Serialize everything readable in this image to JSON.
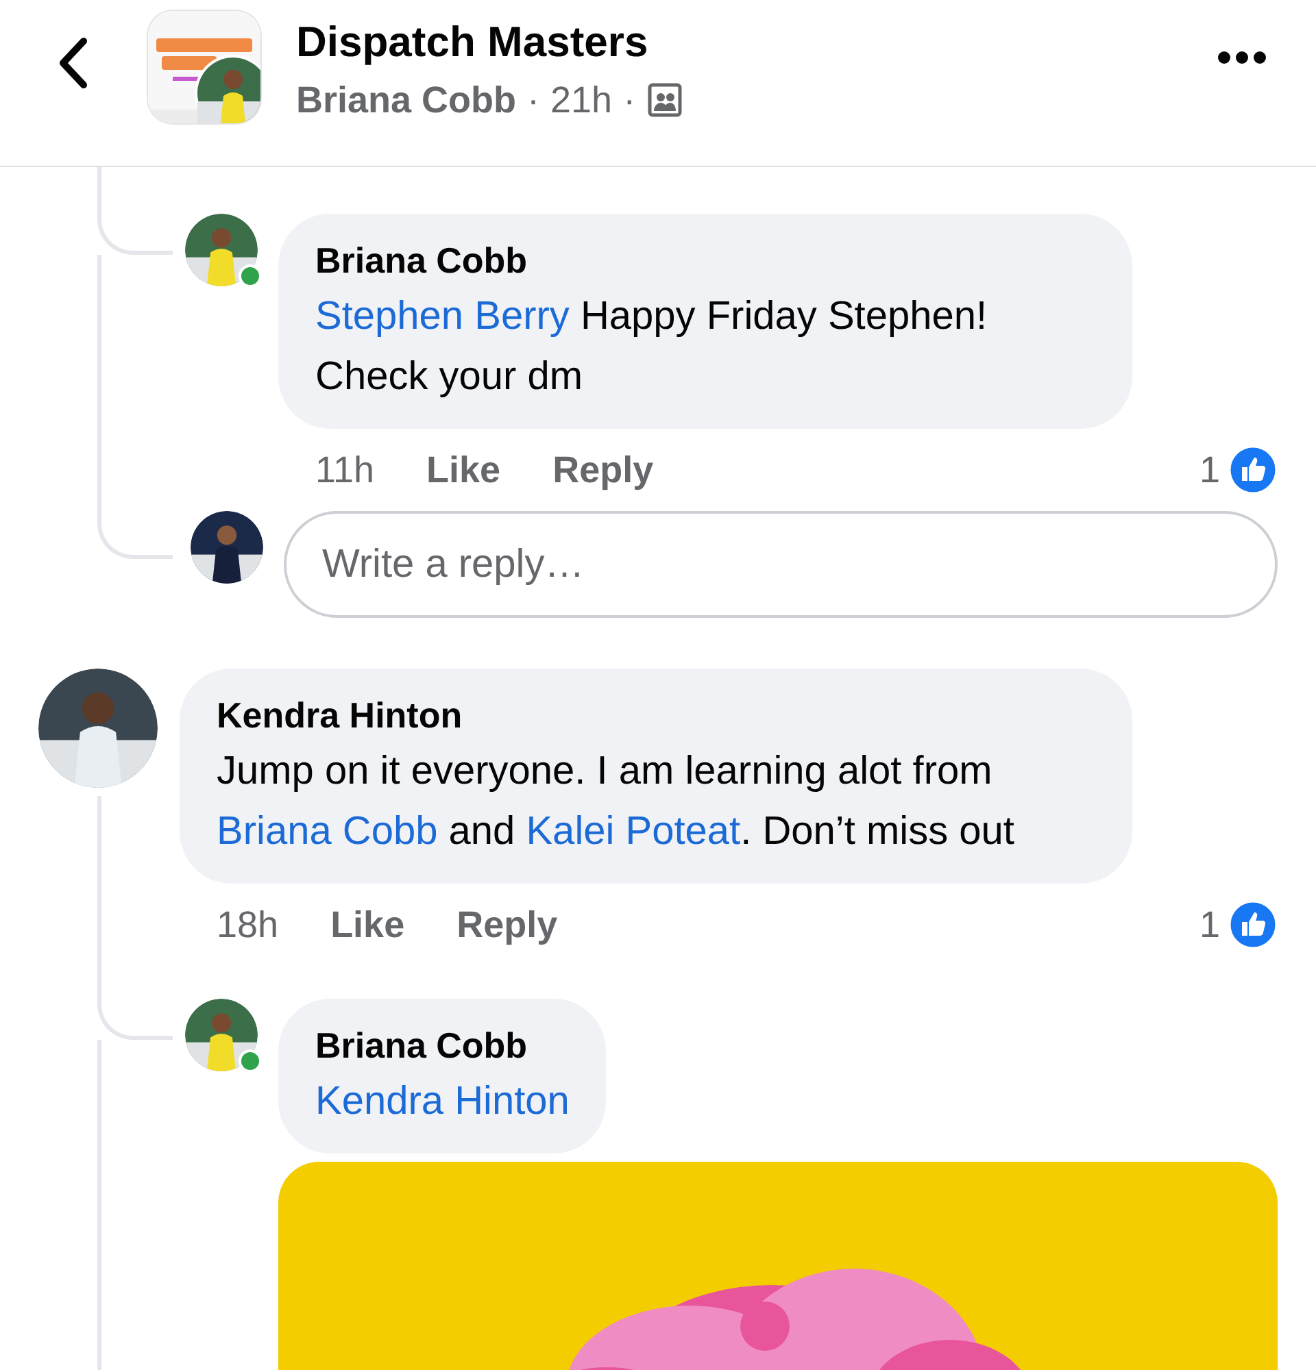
{
  "header": {
    "title": "Dispatch Masters",
    "author": "Briana Cobb",
    "time": "21h",
    "separator": "·"
  },
  "comments": [
    {
      "kind": "reply",
      "author": "Briana Cobb",
      "online": true,
      "body": [
        {
          "kind": "mention",
          "text": "Stephen Berry"
        },
        {
          "kind": "text",
          "text": " Happy Friday Stephen! Check your dm"
        }
      ],
      "time": "11h",
      "actions": [
        "Like",
        "Reply"
      ],
      "reactions": "1",
      "continues": true
    },
    {
      "kind": "composer",
      "placeholder": "Write a reply…",
      "continues": false
    },
    {
      "kind": "top",
      "author": "Kendra Hinton",
      "online": false,
      "body": [
        {
          "kind": "text",
          "text": "Jump on it everyone. I am learning alot from "
        },
        {
          "kind": "mention",
          "text": "Briana Cobb"
        },
        {
          "kind": "text",
          "text": " and "
        },
        {
          "kind": "mention",
          "text": "Kalei Poteat"
        },
        {
          "kind": "text",
          "text": ". Don’t miss out"
        }
      ],
      "time": "18h",
      "actions": [
        "Like",
        "Reply"
      ],
      "reactions": "1",
      "continues": true
    },
    {
      "kind": "reply",
      "author": "Briana Cobb",
      "online": true,
      "body": [
        {
          "kind": "mention",
          "text": "Kendra Hinton"
        }
      ],
      "attachment": {
        "kind": "picture"
      },
      "continues": true
    }
  ]
}
